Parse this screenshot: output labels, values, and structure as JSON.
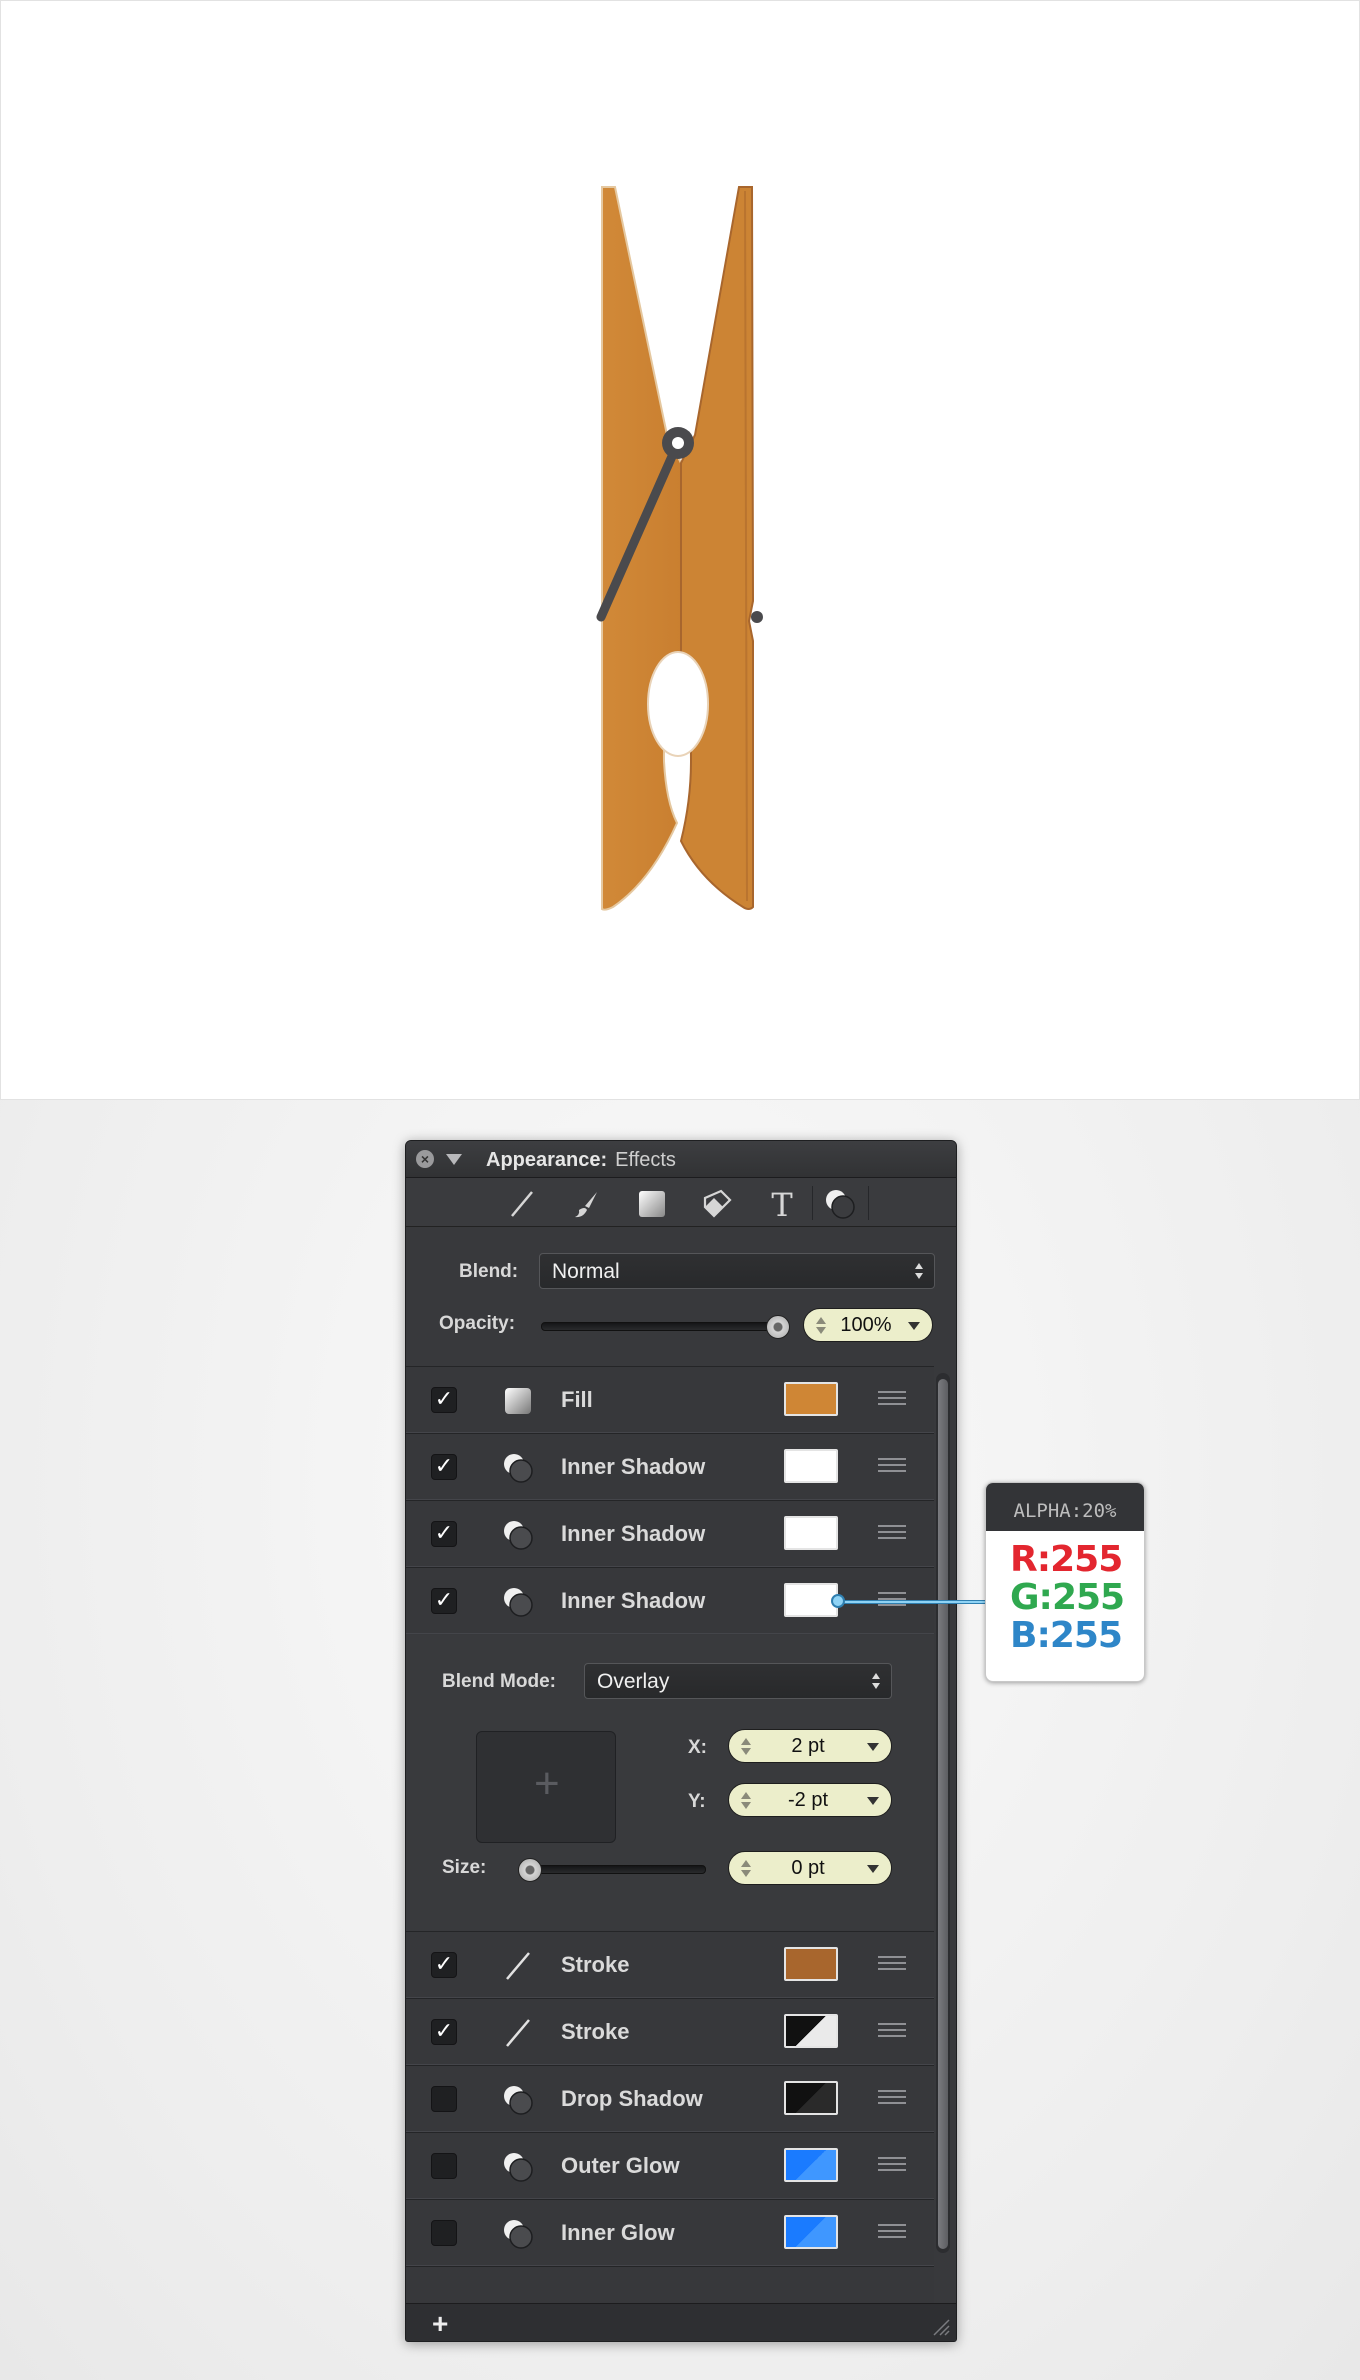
{
  "panel": {
    "title": "Appearance:",
    "subtitle": "Effects",
    "tools": [
      "line-tool-icon",
      "brush-tool-icon",
      "fill-tool-icon",
      "tag-tool-icon",
      "text-tool-icon",
      "effects-tool-icon"
    ],
    "blend_label": "Blend:",
    "blend_value": "Normal",
    "opacity_label": "Opacity:",
    "opacity_value": "100%",
    "opacity_fraction": 1.0
  },
  "effects_top": [
    {
      "checked": true,
      "icon": "fill-icon",
      "label": "Fill",
      "swatch": "#cf8635"
    },
    {
      "checked": true,
      "icon": "shadow-icon",
      "label": "Inner Shadow",
      "swatch": "#ffffff"
    },
    {
      "checked": true,
      "icon": "shadow-icon",
      "label": "Inner Shadow",
      "swatch": "#ffffff"
    },
    {
      "checked": true,
      "icon": "shadow-icon",
      "label": "Inner Shadow",
      "swatch": "#ffffff"
    }
  ],
  "detail": {
    "blend_mode_label": "Blend Mode:",
    "blend_mode_value": "Overlay",
    "x_label": "X:",
    "x_value": "2 pt",
    "y_label": "Y:",
    "y_value": "-2 pt",
    "size_label": "Size:",
    "size_value": "0 pt",
    "size_fraction": 0.0
  },
  "effects_bottom": [
    {
      "checked": true,
      "icon": "stroke-icon",
      "label": "Stroke",
      "swatch": "#a8662d"
    },
    {
      "checked": true,
      "icon": "stroke-icon",
      "label": "Stroke",
      "swatch": "black-white-diagonal"
    },
    {
      "checked": false,
      "icon": "shadow-icon",
      "label": "Drop Shadow",
      "swatch": "black-diagonal"
    },
    {
      "checked": false,
      "icon": "shadow-icon",
      "label": "Outer Glow",
      "swatch": "blue-diagonal"
    },
    {
      "checked": false,
      "icon": "shadow-icon",
      "label": "Inner Glow",
      "swatch": "blue-diagonal"
    }
  ],
  "footer": {
    "add_label": "+"
  },
  "callout": {
    "header": "ALPHA:20%",
    "r": "R:255",
    "g": "G:255",
    "b": "B:255",
    "r_color": "#e3262f",
    "g_color": "#2fa84f",
    "b_color": "#2e86c8"
  },
  "colors": {
    "clothespin": "#cf8635",
    "clothespin_edge": "#a8662d",
    "spring": "#4a4a4d"
  }
}
